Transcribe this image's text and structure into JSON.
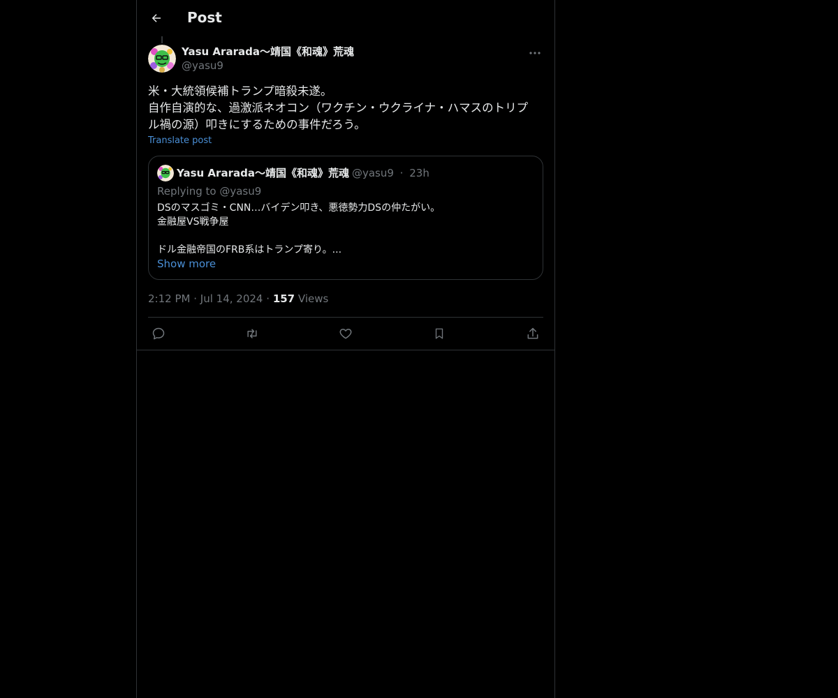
{
  "header": {
    "back_icon": "arrow-left-icon",
    "title": "Post"
  },
  "post": {
    "author_name": "Yasu Ararada〜靖国《和魂》荒魂",
    "author_handle": "@yasu9",
    "more_icon": "more-horizontal-icon",
    "text_lines": [
      "米・大統領候補トランプ暗殺未遂。",
      "自作自演的な、過激派ネオコン（ワクチン・ウクライナ・ハマスのトリプ",
      "ル禍の源）叩きにするための事件だろう。"
    ],
    "translate_label": "Translate post",
    "quote": {
      "author_name": "Yasu Ararada〜靖国《和魂》荒魂",
      "author_handle": "@yasu9",
      "separator": "·",
      "time": "23h",
      "replying_prefix": "Replying to",
      "replying_handle": "@yasu9",
      "body_lines": [
        "DSのマスゴミ・CNN…バイデン叩き、悪徳勢力DSの仲たがい。",
        "金融屋VS戦争屋",
        "",
        "ドル金融帝国のFRB系はトランプ寄り。..."
      ],
      "show_more_label": "Show more"
    },
    "time": "2:12 PM",
    "separator": "·",
    "date": "Jul 14, 2024",
    "views_count": "157",
    "views_label": "Views"
  },
  "actions": [
    {
      "name": "reply",
      "icon": "reply-icon"
    },
    {
      "name": "repost",
      "icon": "repost-icon"
    },
    {
      "name": "like",
      "icon": "heart-icon"
    },
    {
      "name": "bookmark",
      "icon": "bookmark-icon"
    },
    {
      "name": "share",
      "icon": "share-icon"
    }
  ],
  "colors": {
    "background": "#000000",
    "text": "#e7e9ea",
    "muted": "#71767b",
    "link": "#4a8fd6",
    "border": "#2f3336"
  }
}
